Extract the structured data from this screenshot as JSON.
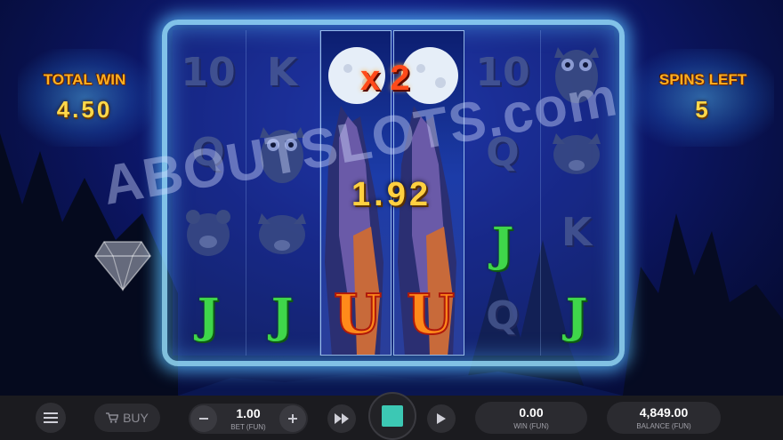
{
  "panels": {
    "total_win_label": "TOTAL WIN",
    "total_win_value": "4.50",
    "spins_left_label": "SPINS LEFT",
    "spins_left_value": "5"
  },
  "reels": {
    "reel1": [
      "10",
      "Q",
      "bear-icon",
      "J"
    ],
    "reel2": [
      "K",
      "owl-icon",
      "boar-icon",
      "J"
    ],
    "reel3": [
      "wild-wolf-moon"
    ],
    "reel4": [
      "wild-wolf-moon"
    ],
    "reel5": [
      "10",
      "Q",
      "J",
      "Q"
    ],
    "reel6": [
      "owl-icon",
      "boar-icon",
      "K",
      "J"
    ],
    "multiplier": "x 2",
    "line_win": "1.92",
    "watermark": "ABOUTSLOTS.com"
  },
  "bottom_bar": {
    "buy_label": "BUY",
    "bet_value": "1.00",
    "bet_label": "BET (FUN)",
    "win_value": "0.00",
    "win_label": "WIN (FUN)",
    "balance_value": "4,849.00",
    "balance_label": "BALANCE (FUN)"
  },
  "colors": {
    "spin_button": "#3cc8b4",
    "frame_glow": "#5ab4ff",
    "title_gold": "#ffb020"
  },
  "icons": [
    "menu-icon",
    "cart-icon",
    "minus-icon",
    "plus-icon",
    "fast-forward-icon",
    "spin-stop-icon",
    "autoplay-icon",
    "diamond-icon"
  ]
}
